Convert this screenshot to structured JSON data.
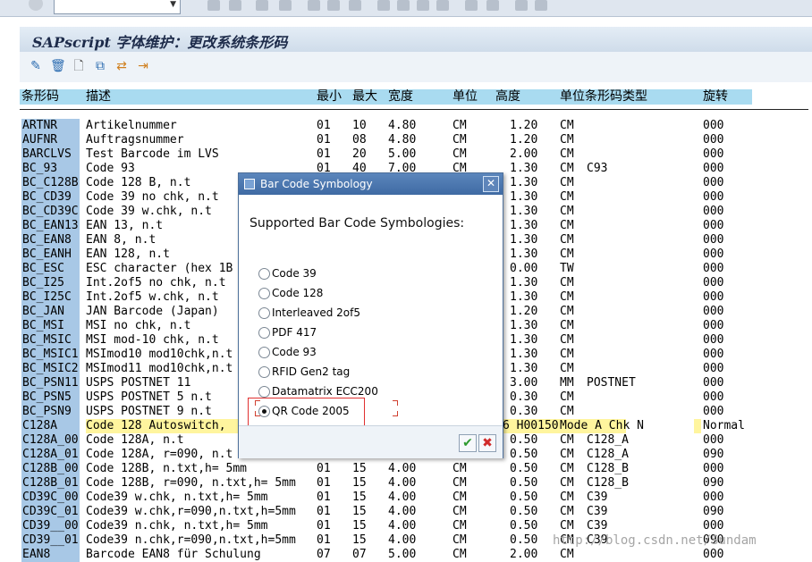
{
  "title": "SAPscript 字体维护：更改系统条形码",
  "columns": {
    "code": "条形码",
    "desc": "描述",
    "min": "最小",
    "max": "最大",
    "width": "宽度",
    "unit": "单位",
    "height": "高度",
    "unit_type": "单位条形码类型",
    "rotation": "旋转"
  },
  "rows": [
    {
      "code": "ARTNR",
      "desc": "Artikelnummer",
      "min": "01",
      "max": "10",
      "width": "4.80",
      "unit": "CM",
      "height": "1.20",
      "unit2": "CM",
      "type": "",
      "rot": "000"
    },
    {
      "code": "AUFNR",
      "desc": "Auftragsnummer",
      "min": "01",
      "max": "08",
      "width": "4.80",
      "unit": "CM",
      "height": "1.20",
      "unit2": "CM",
      "type": "",
      "rot": "000"
    },
    {
      "code": "BARCLVS",
      "desc": "Test Barcode im LVS",
      "min": "01",
      "max": "20",
      "width": "5.00",
      "unit": "CM",
      "height": "2.00",
      "unit2": "CM",
      "type": "",
      "rot": "000"
    },
    {
      "code": "BC_93",
      "desc": "Code 93",
      "min": "01",
      "max": "40",
      "width": "7.00",
      "unit": "CM",
      "height": "1.30",
      "unit2": "CM",
      "type": "C93",
      "rot": "000"
    },
    {
      "code": "BC_C128B",
      "desc": "Code 128 B,       n.t",
      "min": "",
      "max": "",
      "width": "",
      "unit": "",
      "height": "1.30",
      "unit2": "CM",
      "type": "",
      "rot": "000"
    },
    {
      "code": "BC_CD39",
      "desc": "Code 39 no chk,    n.t",
      "min": "",
      "max": "",
      "width": "",
      "unit": "",
      "height": "1.30",
      "unit2": "CM",
      "type": "",
      "rot": "000"
    },
    {
      "code": "BC_CD39C",
      "desc": "Code 39 w.chk,     n.t",
      "min": "",
      "max": "",
      "width": "",
      "unit": "",
      "height": "1.30",
      "unit2": "CM",
      "type": "",
      "rot": "000"
    },
    {
      "code": "BC_EAN13",
      "desc": "EAN 13,           n.t",
      "min": "",
      "max": "",
      "width": "",
      "unit": "",
      "height": "1.30",
      "unit2": "CM",
      "type": "",
      "rot": "000"
    },
    {
      "code": "BC_EAN8",
      "desc": "EAN 8,            n.t",
      "min": "",
      "max": "",
      "width": "",
      "unit": "",
      "height": "1.30",
      "unit2": "CM",
      "type": "",
      "rot": "000"
    },
    {
      "code": "BC_EANH",
      "desc": "EAN 128,          n.t",
      "min": "",
      "max": "",
      "width": "",
      "unit": "",
      "height": "1.30",
      "unit2": "CM",
      "type": "",
      "rot": "000"
    },
    {
      "code": "BC_ESC",
      "desc": "ESC character (hex 1B",
      "min": "",
      "max": "",
      "width": "",
      "unit": "",
      "height": "0.00",
      "unit2": "TW",
      "type": "",
      "rot": "000"
    },
    {
      "code": "BC_I25",
      "desc": "Int.2of5 no chk,  n.t",
      "min": "",
      "max": "",
      "width": "",
      "unit": "",
      "height": "1.30",
      "unit2": "CM",
      "type": "",
      "rot": "000"
    },
    {
      "code": "BC_I25C",
      "desc": "Int.2of5 w.chk,   n.t",
      "min": "",
      "max": "",
      "width": "",
      "unit": "",
      "height": "1.30",
      "unit2": "CM",
      "type": "",
      "rot": "000"
    },
    {
      "code": "BC_JAN",
      "desc": "JAN Barcode (Japan)",
      "min": "",
      "max": "",
      "width": "",
      "unit": "",
      "height": "1.20",
      "unit2": "CM",
      "type": "",
      "rot": "000"
    },
    {
      "code": "BC_MSI",
      "desc": "MSI no chk,       n.t",
      "min": "",
      "max": "",
      "width": "",
      "unit": "",
      "height": "1.30",
      "unit2": "CM",
      "type": "",
      "rot": "000"
    },
    {
      "code": "BC_MSIC",
      "desc": "MSI mod-10 chk,   n.t",
      "min": "",
      "max": "",
      "width": "",
      "unit": "",
      "height": "1.30",
      "unit2": "CM",
      "type": "",
      "rot": "000"
    },
    {
      "code": "BC_MSIC1",
      "desc": "MSImod10 mod10chk,n.t",
      "min": "",
      "max": "",
      "width": "",
      "unit": "",
      "height": "1.30",
      "unit2": "CM",
      "type": "",
      "rot": "000"
    },
    {
      "code": "BC_MSIC2",
      "desc": "MSImod11 mod10chk,n.t",
      "min": "",
      "max": "",
      "width": "",
      "unit": "",
      "height": "1.30",
      "unit2": "CM",
      "type": "",
      "rot": "000"
    },
    {
      "code": "BC_PSN11",
      "desc": "USPS POSTNET 11",
      "min": "",
      "max": "",
      "width": "",
      "unit": "",
      "height": "3.00",
      "unit2": "MM",
      "type": "POSTNET",
      "rot": "000"
    },
    {
      "code": "BC_PSN5",
      "desc": "USPS POSTNET 5    n.t",
      "min": "",
      "max": "",
      "width": "",
      "unit": "",
      "height": "0.30",
      "unit2": "CM",
      "type": "",
      "rot": "000"
    },
    {
      "code": "BC_PSN9",
      "desc": "USPS POSTNET 9    n.t",
      "min": "",
      "max": "",
      "width": "",
      "unit": "",
      "height": "0.30",
      "unit2": "CM",
      "type": "",
      "rot": "000"
    },
    {
      "code": "C128A",
      "desc": "Code 128 Autoswitch,",
      "min": "",
      "max": "",
      "width": "",
      "unit": "",
      "height": "6 H00150",
      "unit2": "Mode A Chk N",
      "type": "",
      "rot": "Normal",
      "highlight": true
    },
    {
      "code": "C128A_00",
      "desc": "Code 128A,        n.t",
      "min": "",
      "max": "",
      "width": "",
      "unit": "",
      "height": "0.50",
      "unit2": "CM",
      "type": "C128_A",
      "rot": "000"
    },
    {
      "code": "C128A_01",
      "desc": "Code 128A, r=090, n.t",
      "min": "",
      "max": "",
      "width": "",
      "unit": "",
      "height": "0.50",
      "unit2": "CM",
      "type": "C128_A",
      "rot": "090"
    },
    {
      "code": "C128B_00",
      "desc": "Code 128B,        n.txt,h= 5mm",
      "min": "01",
      "max": "15",
      "width": "4.00",
      "unit": "CM",
      "height": "0.50",
      "unit2": "CM",
      "type": "C128_B",
      "rot": "000"
    },
    {
      "code": "C128B_01",
      "desc": "Code 128B, r=090, n.txt,h= 5mm",
      "min": "01",
      "max": "15",
      "width": "4.00",
      "unit": "CM",
      "height": "0.50",
      "unit2": "CM",
      "type": "C128_B",
      "rot": "090"
    },
    {
      "code": "CD39C_00",
      "desc": "Code39 w.chk,     n.txt,h= 5mm",
      "min": "01",
      "max": "15",
      "width": "4.00",
      "unit": "CM",
      "height": "0.50",
      "unit2": "CM",
      "type": "C39",
      "rot": "000"
    },
    {
      "code": "CD39C_01",
      "desc": "Code39 w.chk,r=090,n.txt,h=5mm",
      "min": "01",
      "max": "15",
      "width": "4.00",
      "unit": "CM",
      "height": "0.50",
      "unit2": "CM",
      "type": "C39",
      "rot": "090"
    },
    {
      "code": "CD39__00",
      "desc": "Code39 n.chk,     n.txt,h= 5mm",
      "min": "01",
      "max": "15",
      "width": "4.00",
      "unit": "CM",
      "height": "0.50",
      "unit2": "CM",
      "type": "C39",
      "rot": "000"
    },
    {
      "code": "CD39__01",
      "desc": "Code39 n.chk,r=090,n.txt,h=5mm",
      "min": "01",
      "max": "15",
      "width": "4.00",
      "unit": "CM",
      "height": "0.50",
      "unit2": "CM",
      "type": "C39",
      "rot": "090"
    },
    {
      "code": "EAN8",
      "desc": "Barcode EAN8 für Schulung",
      "min": "07",
      "max": "07",
      "width": "5.00",
      "unit": "CM",
      "height": "2.00",
      "unit2": "CM",
      "type": "",
      "rot": "000"
    }
  ],
  "dialog": {
    "title": "Bar Code Symbology",
    "heading": "Supported Bar Code Symbologies:",
    "options": [
      "Code 39",
      "Code 128",
      "Interleaved 2of5",
      "PDF 417",
      "Code 93",
      "RFID Gen2 tag",
      "Datamatrix ECC200",
      "QR Code 2005"
    ],
    "selected": "QR Code 2005",
    "confirm_label": "✔",
    "cancel_label": "✖"
  },
  "watermark": "http://blog.csdn.net/Sundam",
  "colors": {
    "header_bg": "#a9dbf0",
    "code_bg": "#a8c8e6",
    "highlight": "#fff59e",
    "dialog_title": "#3f6aa3"
  }
}
